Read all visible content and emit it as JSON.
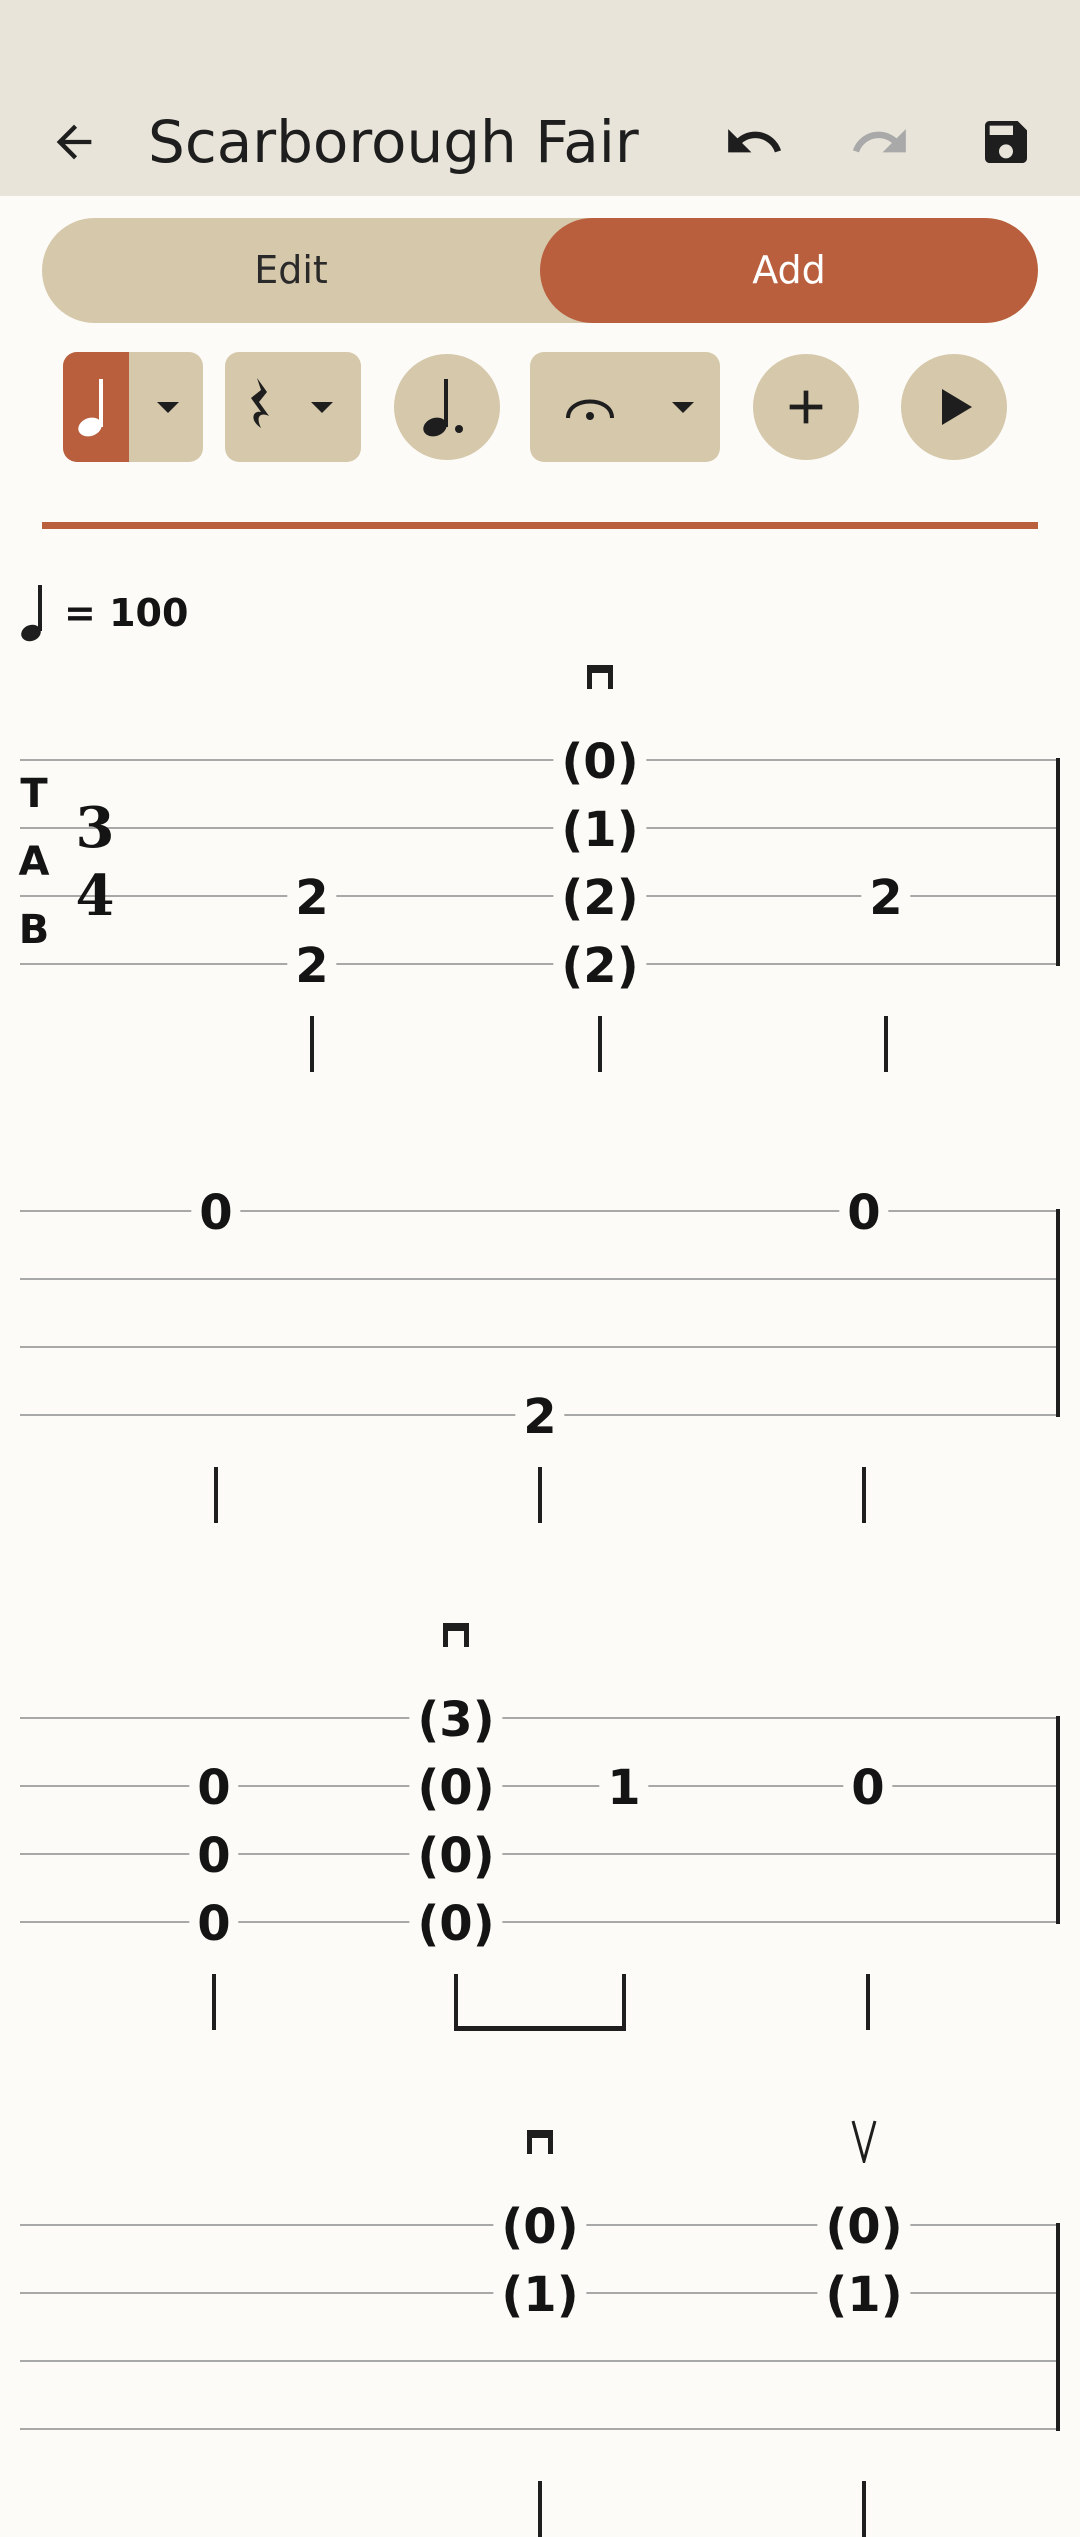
{
  "app": {
    "title": "Scarborough Fair"
  },
  "toolbar": {
    "back_icon": "arrow-left-icon",
    "undo_icon": "undo-icon",
    "redo_icon": "redo-icon",
    "redo_enabled": false,
    "save_icon": "floppy-disk-icon"
  },
  "mode": {
    "edit_label": "Edit",
    "add_label": "Add",
    "selected": "Add"
  },
  "tools": [
    {
      "name": "quarter-note",
      "icon": "quarter-note-icon",
      "active": true,
      "dropdown": true
    },
    {
      "name": "rest",
      "icon": "quarter-rest-icon",
      "active": false,
      "dropdown": true
    },
    {
      "name": "dotted-note",
      "icon": "dotted-note-icon",
      "active": false,
      "dropdown": false
    },
    {
      "name": "fermata",
      "icon": "fermata-icon",
      "active": false,
      "dropdown": true
    },
    {
      "name": "add",
      "icon": "plus-icon",
      "active": false,
      "dropdown": false
    },
    {
      "name": "play",
      "icon": "play-icon",
      "active": false,
      "dropdown": false
    }
  ],
  "colors": {
    "accent": "#B95F3E",
    "chip": "#D6C8AA",
    "appbar": "#E8E4D9",
    "background": "#FCFBF7"
  },
  "score": {
    "tempo": "= 100",
    "tab_letters": [
      "T",
      "A",
      "B"
    ],
    "time_signature": {
      "top": "3",
      "bottom": "4"
    },
    "systems": [
      {
        "beats": [
          {
            "marks": [],
            "frets": [
              "",
              "",
              "2",
              "2"
            ]
          },
          {
            "marks": [
              "down-bow"
            ],
            "frets": [
              "(0)",
              "(1)",
              "(2)",
              "(2)"
            ]
          },
          {
            "marks": [],
            "frets": [
              "",
              "",
              "2",
              ""
            ]
          }
        ]
      },
      {
        "beats": [
          {
            "marks": [],
            "frets": [
              "0",
              "",
              "",
              ""
            ]
          },
          {
            "marks": [],
            "frets": [
              "",
              "",
              "",
              "2"
            ]
          },
          {
            "marks": [],
            "frets": [
              "0",
              "",
              "",
              ""
            ]
          }
        ]
      },
      {
        "beats": [
          {
            "marks": [],
            "frets": [
              "",
              "0",
              "0",
              "0"
            ]
          },
          {
            "marks": [
              "down-bow"
            ],
            "frets": [
              "(3)",
              "(0)",
              "(0)",
              "(0)"
            ]
          },
          {
            "marks": [],
            "frets": [
              "",
              "1",
              "",
              ""
            ]
          },
          {
            "marks": [],
            "frets": [
              "",
              "0",
              "",
              ""
            ]
          }
        ]
      },
      {
        "beats": [
          {
            "marks": [
              "down-bow"
            ],
            "frets": [
              "(0)",
              "(1)",
              "",
              ""
            ]
          },
          {
            "marks": [
              "up-bow"
            ],
            "frets": [
              "(0)",
              "(1)",
              "",
              ""
            ]
          }
        ]
      }
    ]
  }
}
